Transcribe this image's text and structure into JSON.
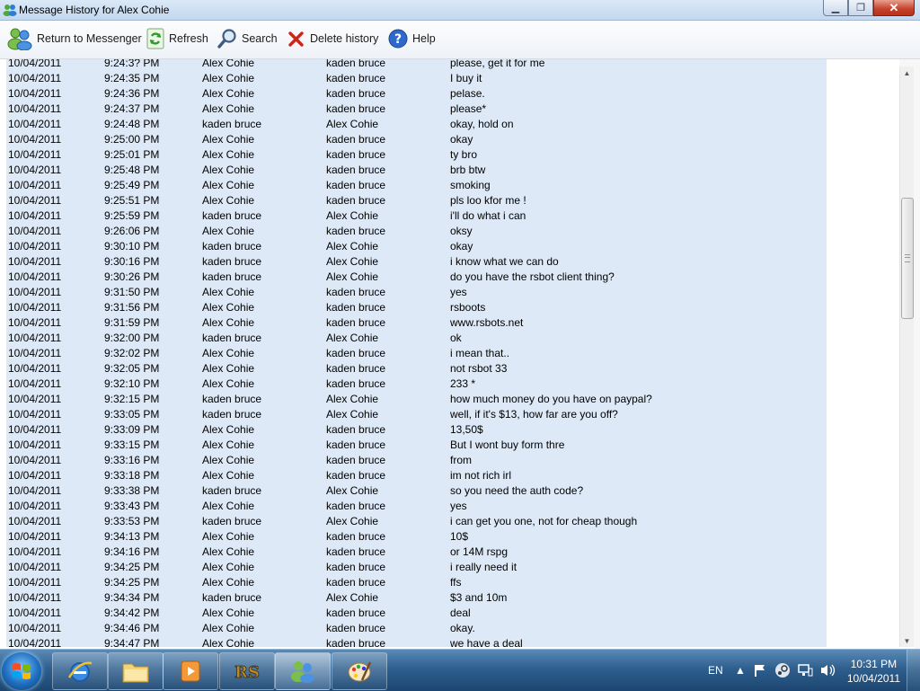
{
  "window": {
    "title": "Message History for Alex Cohie"
  },
  "toolbar": {
    "return_label": "Return to Messenger",
    "refresh_label": "Refresh",
    "search_label": "Search",
    "delete_label": "Delete history",
    "help_label": "Help"
  },
  "partial_row": {
    "date": "10/04/2011",
    "time": "9:24:3? PM",
    "from": "Alex Cohie",
    "to": "kaden bruce",
    "msg": "please, get it for me"
  },
  "messages": [
    [
      "10/04/2011",
      "9:24:35 PM",
      "Alex Cohie",
      "kaden bruce",
      "I buy it"
    ],
    [
      "10/04/2011",
      "9:24:36 PM",
      "Alex Cohie",
      "kaden bruce",
      "pelase."
    ],
    [
      "10/04/2011",
      "9:24:37 PM",
      "Alex Cohie",
      "kaden bruce",
      "please*"
    ],
    [
      "10/04/2011",
      "9:24:48 PM",
      "kaden bruce",
      "Alex Cohie",
      "okay, hold on"
    ],
    [
      "10/04/2011",
      "9:25:00 PM",
      "Alex Cohie",
      "kaden bruce",
      "okay"
    ],
    [
      "10/04/2011",
      "9:25:01 PM",
      "Alex Cohie",
      "kaden bruce",
      "ty bro"
    ],
    [
      "10/04/2011",
      "9:25:48 PM",
      "Alex Cohie",
      "kaden bruce",
      "brb btw"
    ],
    [
      "10/04/2011",
      "9:25:49 PM",
      "Alex Cohie",
      "kaden bruce",
      "smoking"
    ],
    [
      "10/04/2011",
      "9:25:51 PM",
      "Alex Cohie",
      "kaden bruce",
      "pls loo kfor me !"
    ],
    [
      "10/04/2011",
      "9:25:59 PM",
      "kaden bruce",
      "Alex Cohie",
      "i'll do what i can"
    ],
    [
      "10/04/2011",
      "9:26:06 PM",
      "Alex Cohie",
      "kaden bruce",
      "oksy"
    ],
    [
      "10/04/2011",
      "9:30:10 PM",
      "kaden bruce",
      "Alex Cohie",
      "okay"
    ],
    [
      "10/04/2011",
      "9:30:16 PM",
      "kaden bruce",
      "Alex Cohie",
      "i know what we can do"
    ],
    [
      "10/04/2011",
      "9:30:26 PM",
      "kaden bruce",
      "Alex Cohie",
      "do you have the rsbot client thing?"
    ],
    [
      "10/04/2011",
      "9:31:50 PM",
      "Alex Cohie",
      "kaden bruce",
      "yes"
    ],
    [
      "10/04/2011",
      "9:31:56 PM",
      "Alex Cohie",
      "kaden bruce",
      "rsboots"
    ],
    [
      "10/04/2011",
      "9:31:59 PM",
      "Alex Cohie",
      "kaden bruce",
      "www.rsbots.net"
    ],
    [
      "10/04/2011",
      "9:32:00 PM",
      "kaden bruce",
      "Alex Cohie",
      "ok"
    ],
    [
      "10/04/2011",
      "9:32:02 PM",
      "Alex Cohie",
      "kaden bruce",
      "i mean that.."
    ],
    [
      "10/04/2011",
      "9:32:05 PM",
      "Alex Cohie",
      "kaden bruce",
      "not rsbot 33"
    ],
    [
      "10/04/2011",
      "9:32:10 PM",
      "Alex Cohie",
      "kaden bruce",
      "233 *"
    ],
    [
      "10/04/2011",
      "9:32:15 PM",
      "kaden bruce",
      "Alex Cohie",
      "how much money do you have on paypal?"
    ],
    [
      "10/04/2011",
      "9:33:05 PM",
      "kaden bruce",
      "Alex Cohie",
      "well, if it's $13, how far are you off?"
    ],
    [
      "10/04/2011",
      "9:33:09 PM",
      "Alex Cohie",
      "kaden bruce",
      "13,50$"
    ],
    [
      "10/04/2011",
      "9:33:15 PM",
      "Alex Cohie",
      "kaden bruce",
      "But I wont buy form thre"
    ],
    [
      "10/04/2011",
      "9:33:16 PM",
      "Alex Cohie",
      "kaden bruce",
      "from"
    ],
    [
      "10/04/2011",
      "9:33:18 PM",
      "Alex Cohie",
      "kaden bruce",
      "im not rich irl"
    ],
    [
      "10/04/2011",
      "9:33:38 PM",
      "kaden bruce",
      "Alex Cohie",
      "so you need the auth code?"
    ],
    [
      "10/04/2011",
      "9:33:43 PM",
      "Alex Cohie",
      "kaden bruce",
      "yes"
    ],
    [
      "10/04/2011",
      "9:33:53 PM",
      "kaden bruce",
      "Alex Cohie",
      "i can get you one, not for cheap though"
    ],
    [
      "10/04/2011",
      "9:34:13 PM",
      "Alex Cohie",
      "kaden bruce",
      "10$"
    ],
    [
      "10/04/2011",
      "9:34:16 PM",
      "Alex Cohie",
      "kaden bruce",
      "or 14M rspg"
    ],
    [
      "10/04/2011",
      "9:34:25 PM",
      "Alex Cohie",
      "kaden bruce",
      "i really need it"
    ],
    [
      "10/04/2011",
      "9:34:25 PM",
      "Alex Cohie",
      "kaden bruce",
      "ffs"
    ],
    [
      "10/04/2011",
      "9:34:34 PM",
      "kaden bruce",
      "Alex Cohie",
      "$3 and 10m"
    ],
    [
      "10/04/2011",
      "9:34:42 PM",
      "Alex Cohie",
      "kaden bruce",
      "deal"
    ],
    [
      "10/04/2011",
      "9:34:46 PM",
      "Alex Cohie",
      "kaden bruce",
      "okay."
    ],
    [
      "10/04/2011",
      "9:34:47 PM",
      "Alex Cohie",
      "kaden bruce",
      "we have a deal"
    ]
  ],
  "taskbar": {
    "apps": [
      "start-orb",
      "internet-explorer",
      "windows-explorer",
      "media-player",
      "runescape",
      "windows-live-messenger",
      "paint"
    ],
    "language": "EN",
    "time": "10:31 PM",
    "date": "10/04/2011"
  }
}
